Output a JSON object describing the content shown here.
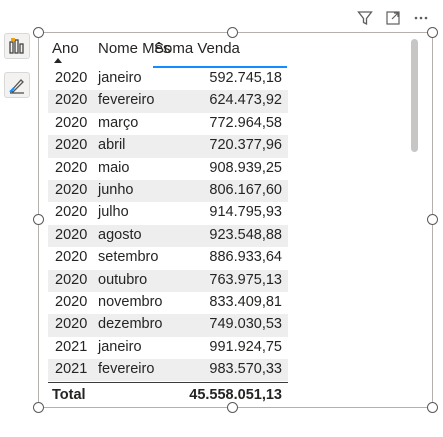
{
  "table": {
    "headers": {
      "ano": "Ano",
      "mes": "Nome Mês",
      "venda": "Soma Venda"
    },
    "rows": [
      {
        "ano": "2020",
        "mes": "janeiro",
        "venda": "592.745,18"
      },
      {
        "ano": "2020",
        "mes": "fevereiro",
        "venda": "624.473,92"
      },
      {
        "ano": "2020",
        "mes": "março",
        "venda": "772.964,58"
      },
      {
        "ano": "2020",
        "mes": "abril",
        "venda": "720.377,96"
      },
      {
        "ano": "2020",
        "mes": "maio",
        "venda": "908.939,25"
      },
      {
        "ano": "2020",
        "mes": "junho",
        "venda": "806.167,60"
      },
      {
        "ano": "2020",
        "mes": "julho",
        "venda": "914.795,93"
      },
      {
        "ano": "2020",
        "mes": "agosto",
        "venda": "923.548,88"
      },
      {
        "ano": "2020",
        "mes": "setembro",
        "venda": "886.933,64"
      },
      {
        "ano": "2020",
        "mes": "outubro",
        "venda": "763.975,13"
      },
      {
        "ano": "2020",
        "mes": "novembro",
        "venda": "833.409,81"
      },
      {
        "ano": "2020",
        "mes": "dezembro",
        "venda": "749.030,53"
      },
      {
        "ano": "2021",
        "mes": "janeiro",
        "venda": "991.924,75"
      },
      {
        "ano": "2021",
        "mes": "fevereiro",
        "venda": "983.570,33"
      }
    ],
    "total": {
      "label": "Total",
      "value": "45.558.051,13"
    }
  },
  "icons": {
    "side": [
      "build-visual-icon",
      "format-visual-icon"
    ],
    "toolbar": [
      "filter-icon",
      "focus-mode-icon",
      "more-options-icon"
    ]
  },
  "colors": {
    "accent": "#118dff",
    "alt_row": "#eeeeee",
    "frame": "#b3b0ad"
  }
}
